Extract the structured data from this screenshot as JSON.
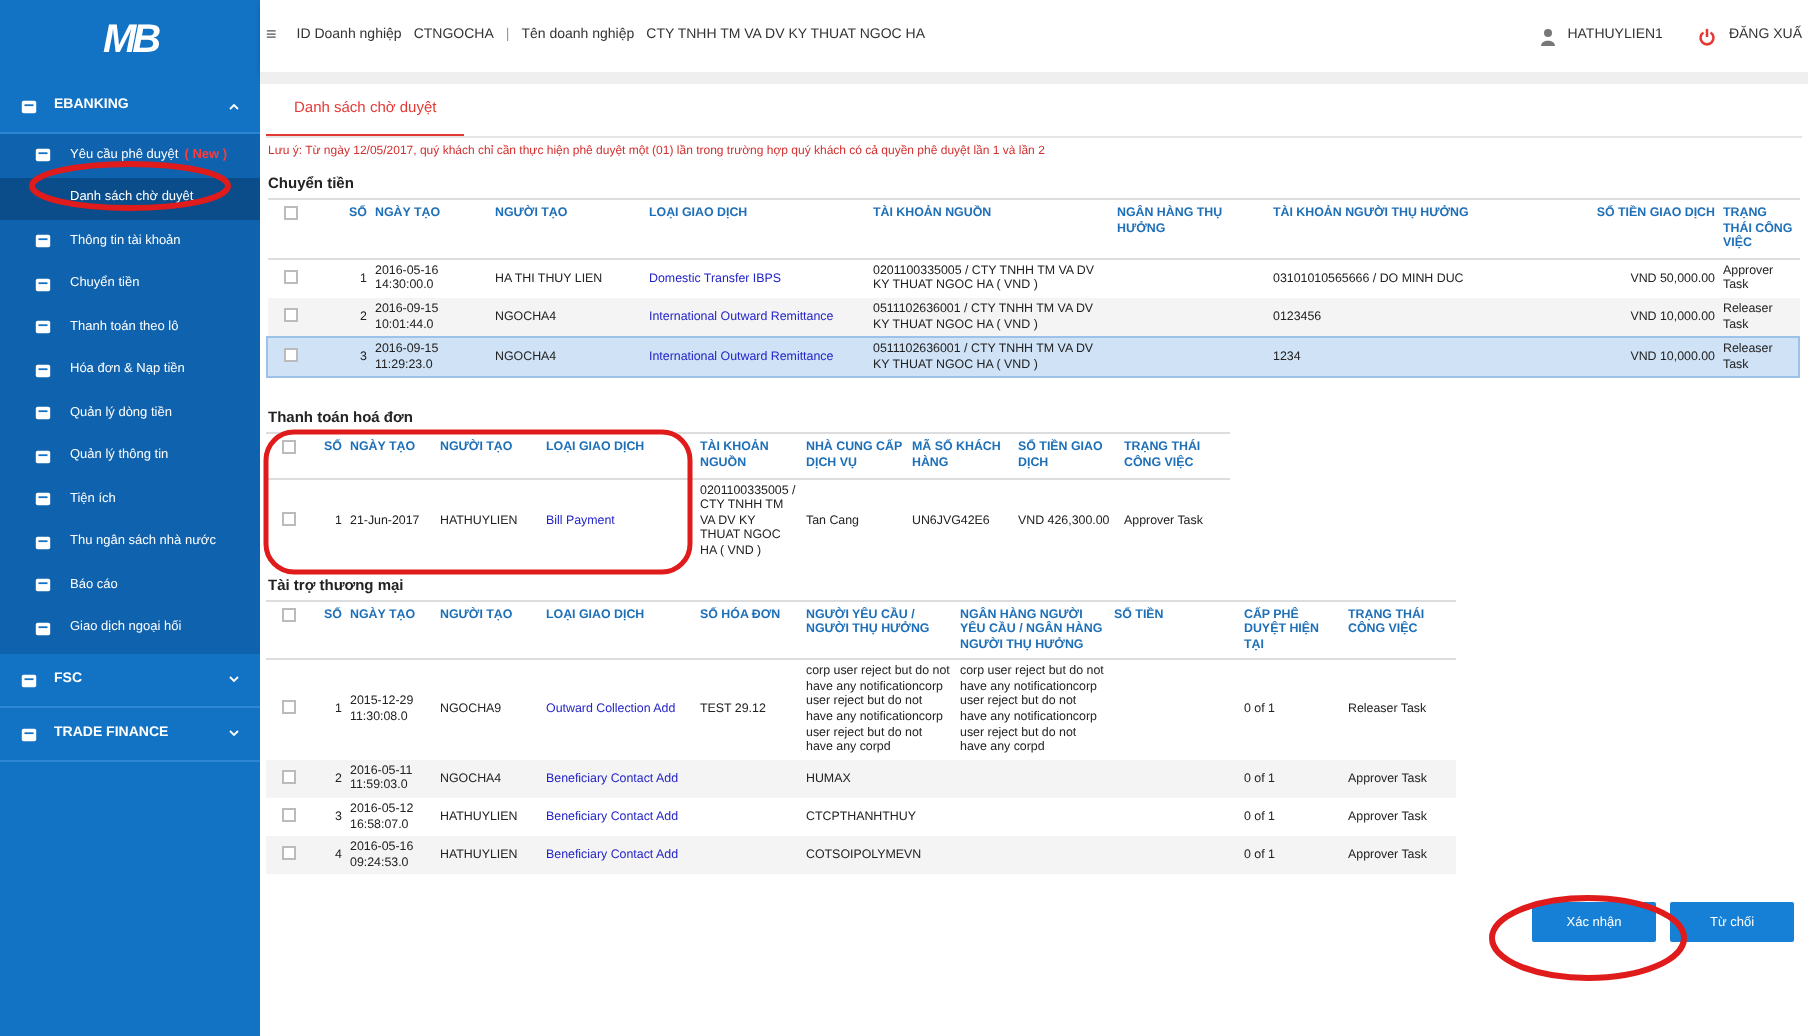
{
  "sidebar": {
    "logo": "MB",
    "groups": [
      {
        "label": "EBANKING",
        "expanded": true,
        "children": [
          {
            "label": "Yêu cầu phê duyệt",
            "badge": "( New )",
            "selected": false,
            "children": [
              {
                "label": "Danh sách chờ duyệt",
                "selected": true
              }
            ]
          },
          {
            "label": "Thông tin tài khoản",
            "selected": false
          },
          {
            "label": "Chuyển tiền",
            "selected": false
          },
          {
            "label": "Thanh toán theo lô",
            "selected": false
          },
          {
            "label": "Hóa đơn & Nạp tiền",
            "selected": false
          },
          {
            "label": "Quản lý dòng tiền",
            "selected": false
          },
          {
            "label": "Quản lý thông tin",
            "selected": false
          },
          {
            "label": "Tiện ích",
            "selected": false
          },
          {
            "label": "Thu ngân sách nhà nước",
            "selected": false
          },
          {
            "label": "Báo cáo",
            "selected": false
          },
          {
            "label": "Giao dịch ngoại hối",
            "selected": false
          }
        ]
      },
      {
        "label": "FSC",
        "expanded": false
      },
      {
        "label": "TRADE FINANCE",
        "expanded": false
      }
    ]
  },
  "header": {
    "menu_icon": "≡",
    "fields": [
      {
        "label": "ID Doanh nghiệp",
        "value": "CTNGOCHA"
      },
      {
        "label": "Tên doanh nghiệp",
        "value": "CTY TNHH TM VA DV KY THUAT NGOC HA"
      }
    ],
    "separator": "|",
    "user": "HATHUYLIEN1",
    "logout": "ĐĂNG XUẤ"
  },
  "tabs": [
    {
      "label": "Danh sách chờ duyệt",
      "selected": true
    }
  ],
  "notice": "Lưu ý: Từ ngày 12/05/2017, quý khách chỉ cần thực hiện phê duyệt một (01) lần trong trường hợp quý khách có cả quyền phê duyệt lần 1 và lần 2",
  "sections": [
    {
      "title": "Chuyển tiền",
      "select_all": false,
      "columns": [
        {
          "label": "SỐ",
          "kind": "num"
        },
        {
          "label": "NGÀY TẠO",
          "kind": "text"
        },
        {
          "label": "NGƯỜI TẠO",
          "kind": "text"
        },
        {
          "label": "LOẠI GIAO DỊCH",
          "kind": "link"
        },
        {
          "label": "TÀI KHOẢN NGUỒN",
          "kind": "text"
        },
        {
          "label": "NGÂN HÀNG THỤ HƯỞNG",
          "kind": "text"
        },
        {
          "label": "TÀI KHOẢN NGƯỜI THỤ HƯỞNG",
          "kind": "text"
        },
        {
          "label": "SỐ TIỀN GIAO DỊCH",
          "kind": "amount"
        },
        {
          "label": "TRẠNG THÁI CÔNG VIỆC",
          "kind": "text"
        }
      ],
      "rows": [
        {
          "checked": false,
          "selected": false,
          "cells": [
            "1",
            "2016-05-16 14:30:00.0",
            "HA THI THUY LIEN",
            "Domestic Transfer IBPS",
            "0201100335005 / CTY TNHH TM VA DV KY THUAT NGOC HA ( VND )",
            "",
            "03101010565666 / DO MINH DUC",
            "VND 50,000.00",
            "Approver Task"
          ]
        },
        {
          "checked": false,
          "selected": false,
          "cells": [
            "2",
            "2016-09-15 10:01:44.0",
            "NGOCHA4",
            "International Outward Remittance",
            "0511102636001 / CTY TNHH TM VA DV KY THUAT NGOC HA ( VND )",
            "",
            "0123456",
            "VND 10,000.00",
            "Releaser Task"
          ]
        },
        {
          "checked": false,
          "selected": true,
          "cells": [
            "3",
            "2016-09-15 11:29:23.0",
            "NGOCHA4",
            "International Outward Remittance",
            "0511102636001 / CTY TNHH TM VA DV KY THUAT NGOC HA ( VND )",
            "",
            "1234",
            "VND 10,000.00",
            "Releaser Task"
          ]
        }
      ]
    },
    {
      "title": "Thanh toán hoá đơn",
      "select_all": false,
      "columns": [
        {
          "label": "SỐ",
          "kind": "num"
        },
        {
          "label": "NGÀY TẠO",
          "kind": "text"
        },
        {
          "label": "NGƯỜI TẠO",
          "kind": "text"
        },
        {
          "label": "LOẠI GIAO DỊCH",
          "kind": "link"
        },
        {
          "label": "TÀI KHOẢN NGUỒN",
          "kind": "text"
        },
        {
          "label": "NHÀ CUNG CẤP DỊCH VỤ",
          "kind": "text"
        },
        {
          "label": "MÃ SỐ KHÁCH HÀNG",
          "kind": "text"
        },
        {
          "label": "SỐ TIỀN GIAO DỊCH",
          "kind": "text"
        },
        {
          "label": "TRẠNG THÁI CÔNG VIỆC",
          "kind": "text"
        }
      ],
      "rows": [
        {
          "checked": false,
          "selected": false,
          "cells": [
            "1",
            "21-Jun-2017",
            "HATHUYLIEN",
            "Bill Payment",
            "0201100335005 / CTY TNHH TM VA DV KY THUAT NGOC HA ( VND )",
            "Tan Cang",
            "UN6JVG42E6",
            "VND 426,300.00",
            "Approver Task"
          ]
        }
      ]
    },
    {
      "title": "Tài trợ thương mại",
      "select_all": false,
      "columns": [
        {
          "label": "SỐ",
          "kind": "num"
        },
        {
          "label": "NGÀY TẠO",
          "kind": "text"
        },
        {
          "label": "NGƯỜI TẠO",
          "kind": "text"
        },
        {
          "label": "LOẠI GIAO DỊCH",
          "kind": "link"
        },
        {
          "label": "SỐ HÓA ĐƠN",
          "kind": "text"
        },
        {
          "label": "NGƯỜI YÊU CẦU / NGƯỜI THỤ HƯỞNG",
          "kind": "text"
        },
        {
          "label": "NGÂN HÀNG NGƯỜI YÊU CẦU / NGÂN HÀNG NGƯỜI THỤ HƯỞNG",
          "kind": "text"
        },
        {
          "label": "SỐ TIỀN",
          "kind": "text"
        },
        {
          "label": "CẤP PHÊ DUYỆT HIỆN TẠI",
          "kind": "text"
        },
        {
          "label": "TRẠNG THÁI CÔNG VIỆC",
          "kind": "text"
        }
      ],
      "rows": [
        {
          "checked": false,
          "selected": false,
          "cells": [
            "1",
            "2015-12-29 11:30:08.0",
            "NGOCHA9",
            "Outward Collection Add",
            "TEST 29.12",
            "corp user reject but do not have any notificationcorp user reject but do not have any notificationcorp user reject but do not have any corpd",
            "corp user reject but do not have any notificationcorp user reject but do not have any notificationcorp user reject but do not have any corpd",
            "",
            "0 of 1",
            "Releaser Task"
          ]
        },
        {
          "checked": false,
          "selected": false,
          "cells": [
            "2",
            "2016-05-11 11:59:03.0",
            "NGOCHA4",
            "Beneficiary Contact Add",
            "",
            "HUMAX",
            "",
            "",
            "0 of 1",
            "Approver Task"
          ]
        },
        {
          "checked": false,
          "selected": false,
          "cells": [
            "3",
            "2016-05-12 16:58:07.0",
            "HATHUYLIEN",
            "Beneficiary Contact Add",
            "",
            "CTCPTHANHTHUY",
            "",
            "",
            "0 of 1",
            "Approver Task"
          ]
        },
        {
          "checked": false,
          "selected": false,
          "cells": [
            "4",
            "2016-05-16 09:24:53.0",
            "HATHUYLIEN",
            "Beneficiary Contact Add",
            "",
            "COTSOIPOLYMEVN",
            "",
            "",
            "0 of 1",
            "Approver Task"
          ]
        }
      ]
    }
  ],
  "buttons": [
    "Xác nhận",
    "Từ chối"
  ]
}
